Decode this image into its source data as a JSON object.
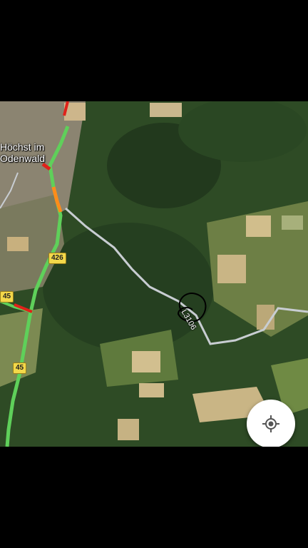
{
  "map": {
    "place_name_line1": "Höchst im",
    "place_name_line2": "Odenwald",
    "road_shields": [
      "426",
      "45",
      "45"
    ],
    "road_label": "L3106",
    "locate_button_icon": "my-location-icon",
    "colors": {
      "traffic_green": "#5fd05a",
      "traffic_orange": "#ff8c1a",
      "traffic_red": "#e0221a",
      "shield_yellow": "#f3d84a",
      "road_grey": "#c8cdd2"
    }
  }
}
